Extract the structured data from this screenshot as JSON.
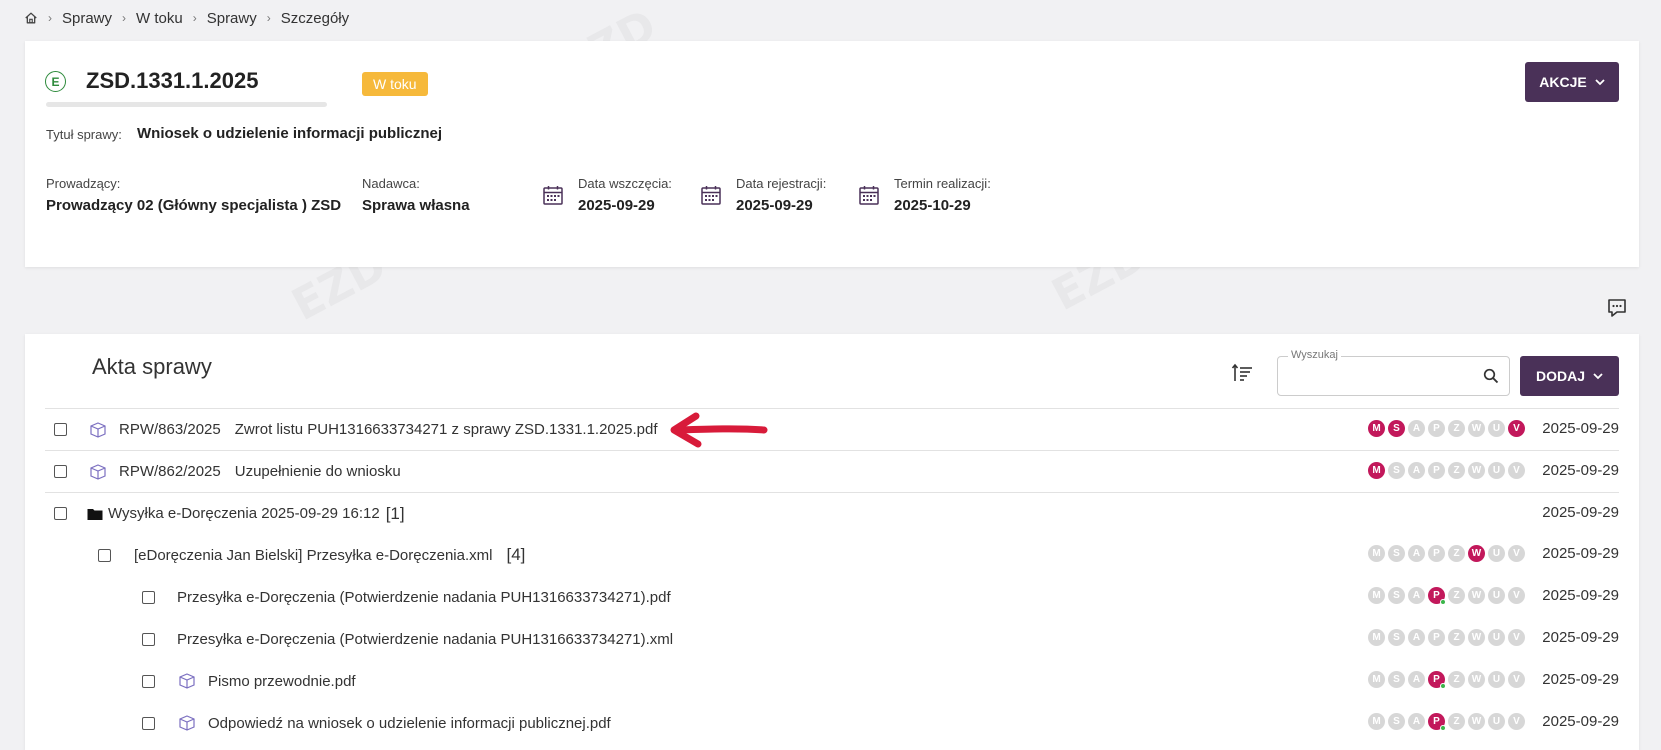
{
  "breadcrumb": [
    "Sprawy",
    "W toku",
    "Sprawy",
    "Szczegóły"
  ],
  "case": {
    "icon_letter": "E",
    "number": "ZSD.1331.1.2025",
    "status": "W toku",
    "actions_label": "AKCJE",
    "title_label": "Tytuł sprawy:",
    "title_value": "Wniosek o udzielenie informacji publicznej",
    "lead_label": "Prowadzący:",
    "lead_value": "Prowadzący 02 (Główny specjalista ) ZSD",
    "sender_label": "Nadawca:",
    "sender_value": "Sprawa własna",
    "start_label": "Data wszczęcia:",
    "start_value": "2025-09-29",
    "reg_label": "Data rejestracji:",
    "reg_value": "2025-09-29",
    "due_label": "Termin realizacji:",
    "due_value": "2025-10-29"
  },
  "files": {
    "title": "Akta sprawy",
    "search_label": "Wyszukaj",
    "search_value": "",
    "add_label": "DODAJ",
    "rows": [
      {
        "signature": "RPW/863/2025",
        "name": "Zwrot listu PUH1316633734271 z sprawy ZSD.1331.1.2025.pdf",
        "date": "2025-09-29"
      },
      {
        "signature": "RPW/862/2025",
        "name": "Uzupełnienie do wniosku",
        "date": "2025-09-29"
      },
      {
        "name": "Wysyłka e-Doręczenia 2025-09-29 16:12",
        "count": "[1]",
        "date": "2025-09-29"
      },
      {
        "name": "[eDoręczenia Jan Bielski] Przesyłka e-Doręczenia.xml",
        "count": "[4]",
        "date": "2025-09-29"
      },
      {
        "name": "Przesyłka e-Doręczenia (Potwierdzenie nadania PUH1316633734271).pdf",
        "date": "2025-09-29"
      },
      {
        "name": "Przesyłka e-Doręczenia (Potwierdzenie nadania PUH1316633734271).xml",
        "date": "2025-09-29"
      },
      {
        "name": "Pismo przewodnie.pdf",
        "date": "2025-09-29"
      },
      {
        "name": "Odpowiedź na wniosek o udzielenie informacji publicznej.pdf",
        "date": "2025-09-29"
      }
    ]
  },
  "badge_letters": [
    "M",
    "S",
    "A",
    "P",
    "Z",
    "W",
    "U",
    "V"
  ],
  "colors": {
    "primary": "#4a3158",
    "badge_active": "#c2185b",
    "status": "#f6b93b",
    "arrow": "#d81b3a"
  }
}
